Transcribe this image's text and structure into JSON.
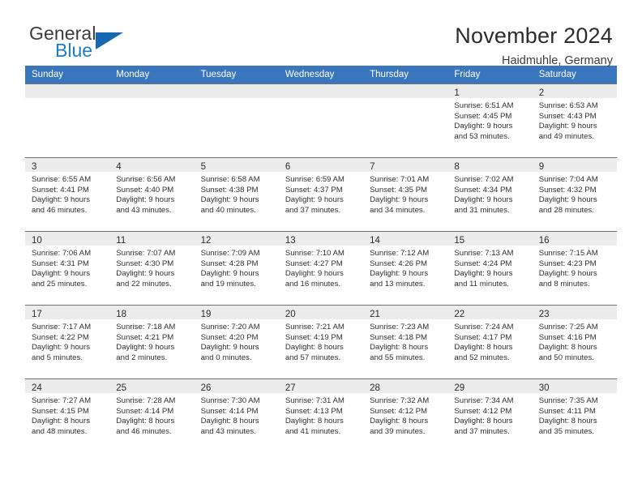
{
  "brand": {
    "name_top": "General",
    "name_bottom": "Blue",
    "triangle_icon": "triangle-icon",
    "colors": {
      "dark": "#3c3c3c",
      "blue": "#1c7cc4",
      "triangle": "#1668b0"
    }
  },
  "header": {
    "title": "November 2024",
    "subtitle": "Haidmuhle, Germany"
  },
  "theme": {
    "header_row_bg": "#3a76bd",
    "daynum_bar_bg": "#ececec",
    "cell_border": "#6f6f6f",
    "page_bg": "#ffffff"
  },
  "weekdays": [
    "Sunday",
    "Monday",
    "Tuesday",
    "Wednesday",
    "Thursday",
    "Friday",
    "Saturday"
  ],
  "labels": {
    "sunrise_prefix": "Sunrise:",
    "sunset_prefix": "Sunset:",
    "daylight_prefix": "Daylight:"
  },
  "weeks": [
    [
      {
        "empty": true
      },
      {
        "empty": true
      },
      {
        "empty": true
      },
      {
        "empty": true
      },
      {
        "empty": true
      },
      {
        "day": "1",
        "sunrise": "Sunrise: 6:51 AM",
        "sunset": "Sunset: 4:45 PM",
        "daylight": "Daylight: 9 hours and 53 minutes."
      },
      {
        "day": "2",
        "sunrise": "Sunrise: 6:53 AM",
        "sunset": "Sunset: 4:43 PM",
        "daylight": "Daylight: 9 hours and 49 minutes."
      }
    ],
    [
      {
        "day": "3",
        "sunrise": "Sunrise: 6:55 AM",
        "sunset": "Sunset: 4:41 PM",
        "daylight": "Daylight: 9 hours and 46 minutes."
      },
      {
        "day": "4",
        "sunrise": "Sunrise: 6:56 AM",
        "sunset": "Sunset: 4:40 PM",
        "daylight": "Daylight: 9 hours and 43 minutes."
      },
      {
        "day": "5",
        "sunrise": "Sunrise: 6:58 AM",
        "sunset": "Sunset: 4:38 PM",
        "daylight": "Daylight: 9 hours and 40 minutes."
      },
      {
        "day": "6",
        "sunrise": "Sunrise: 6:59 AM",
        "sunset": "Sunset: 4:37 PM",
        "daylight": "Daylight: 9 hours and 37 minutes."
      },
      {
        "day": "7",
        "sunrise": "Sunrise: 7:01 AM",
        "sunset": "Sunset: 4:35 PM",
        "daylight": "Daylight: 9 hours and 34 minutes."
      },
      {
        "day": "8",
        "sunrise": "Sunrise: 7:02 AM",
        "sunset": "Sunset: 4:34 PM",
        "daylight": "Daylight: 9 hours and 31 minutes."
      },
      {
        "day": "9",
        "sunrise": "Sunrise: 7:04 AM",
        "sunset": "Sunset: 4:32 PM",
        "daylight": "Daylight: 9 hours and 28 minutes."
      }
    ],
    [
      {
        "day": "10",
        "sunrise": "Sunrise: 7:06 AM",
        "sunset": "Sunset: 4:31 PM",
        "daylight": "Daylight: 9 hours and 25 minutes."
      },
      {
        "day": "11",
        "sunrise": "Sunrise: 7:07 AM",
        "sunset": "Sunset: 4:30 PM",
        "daylight": "Daylight: 9 hours and 22 minutes."
      },
      {
        "day": "12",
        "sunrise": "Sunrise: 7:09 AM",
        "sunset": "Sunset: 4:28 PM",
        "daylight": "Daylight: 9 hours and 19 minutes."
      },
      {
        "day": "13",
        "sunrise": "Sunrise: 7:10 AM",
        "sunset": "Sunset: 4:27 PM",
        "daylight": "Daylight: 9 hours and 16 minutes."
      },
      {
        "day": "14",
        "sunrise": "Sunrise: 7:12 AM",
        "sunset": "Sunset: 4:26 PM",
        "daylight": "Daylight: 9 hours and 13 minutes."
      },
      {
        "day": "15",
        "sunrise": "Sunrise: 7:13 AM",
        "sunset": "Sunset: 4:24 PM",
        "daylight": "Daylight: 9 hours and 11 minutes."
      },
      {
        "day": "16",
        "sunrise": "Sunrise: 7:15 AM",
        "sunset": "Sunset: 4:23 PM",
        "daylight": "Daylight: 9 hours and 8 minutes."
      }
    ],
    [
      {
        "day": "17",
        "sunrise": "Sunrise: 7:17 AM",
        "sunset": "Sunset: 4:22 PM",
        "daylight": "Daylight: 9 hours and 5 minutes."
      },
      {
        "day": "18",
        "sunrise": "Sunrise: 7:18 AM",
        "sunset": "Sunset: 4:21 PM",
        "daylight": "Daylight: 9 hours and 2 minutes."
      },
      {
        "day": "19",
        "sunrise": "Sunrise: 7:20 AM",
        "sunset": "Sunset: 4:20 PM",
        "daylight": "Daylight: 9 hours and 0 minutes."
      },
      {
        "day": "20",
        "sunrise": "Sunrise: 7:21 AM",
        "sunset": "Sunset: 4:19 PM",
        "daylight": "Daylight: 8 hours and 57 minutes."
      },
      {
        "day": "21",
        "sunrise": "Sunrise: 7:23 AM",
        "sunset": "Sunset: 4:18 PM",
        "daylight": "Daylight: 8 hours and 55 minutes."
      },
      {
        "day": "22",
        "sunrise": "Sunrise: 7:24 AM",
        "sunset": "Sunset: 4:17 PM",
        "daylight": "Daylight: 8 hours and 52 minutes."
      },
      {
        "day": "23",
        "sunrise": "Sunrise: 7:25 AM",
        "sunset": "Sunset: 4:16 PM",
        "daylight": "Daylight: 8 hours and 50 minutes."
      }
    ],
    [
      {
        "day": "24",
        "sunrise": "Sunrise: 7:27 AM",
        "sunset": "Sunset: 4:15 PM",
        "daylight": "Daylight: 8 hours and 48 minutes."
      },
      {
        "day": "25",
        "sunrise": "Sunrise: 7:28 AM",
        "sunset": "Sunset: 4:14 PM",
        "daylight": "Daylight: 8 hours and 46 minutes."
      },
      {
        "day": "26",
        "sunrise": "Sunrise: 7:30 AM",
        "sunset": "Sunset: 4:14 PM",
        "daylight": "Daylight: 8 hours and 43 minutes."
      },
      {
        "day": "27",
        "sunrise": "Sunrise: 7:31 AM",
        "sunset": "Sunset: 4:13 PM",
        "daylight": "Daylight: 8 hours and 41 minutes."
      },
      {
        "day": "28",
        "sunrise": "Sunrise: 7:32 AM",
        "sunset": "Sunset: 4:12 PM",
        "daylight": "Daylight: 8 hours and 39 minutes."
      },
      {
        "day": "29",
        "sunrise": "Sunrise: 7:34 AM",
        "sunset": "Sunset: 4:12 PM",
        "daylight": "Daylight: 8 hours and 37 minutes."
      },
      {
        "day": "30",
        "sunrise": "Sunrise: 7:35 AM",
        "sunset": "Sunset: 4:11 PM",
        "daylight": "Daylight: 8 hours and 35 minutes."
      }
    ]
  ]
}
